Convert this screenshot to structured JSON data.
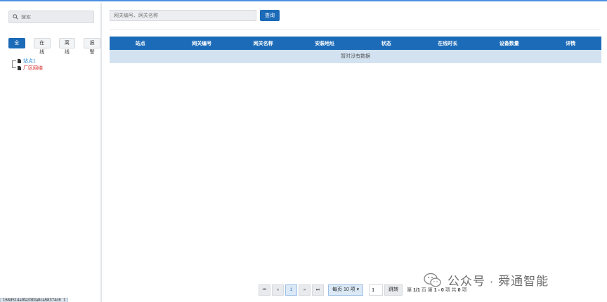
{
  "sidebar": {
    "search_placeholder": "搜索",
    "filters": [
      "全部",
      "在线",
      "离线",
      "报警"
    ],
    "tree": [
      {
        "label": "站点1"
      },
      {
        "label": "厂区网络"
      }
    ]
  },
  "main": {
    "query_placeholder": "网关编号、网关名称",
    "query_button": "查询",
    "columns": [
      "站点",
      "网关编号",
      "网关名称",
      "安装地址",
      "状态",
      "在线时长",
      "设备数量",
      "详情"
    ],
    "empty_text": "暂时没有数据"
  },
  "pager": {
    "first": "⏮",
    "prev": "«",
    "current_page": "1",
    "next": "»",
    "last": "⏭",
    "per_page": "每页 10 项",
    "goto_value": "1",
    "goto_button": "跳转",
    "page_info_prefix": "第",
    "page_info_page": "1/1",
    "page_info_mid": "页 第",
    "page_info_range": "1 - 0",
    "page_info_mid2": "项 共",
    "page_info_total": "0",
    "page_info_suffix": "项"
  },
  "status_bar_text": "168d514a9fa33fda8ca58374c6_1",
  "watermark": "公众号 · 舜通智能",
  "colors": {
    "primary": "#1c6bb8",
    "empty_row": "#d2e2f1"
  }
}
